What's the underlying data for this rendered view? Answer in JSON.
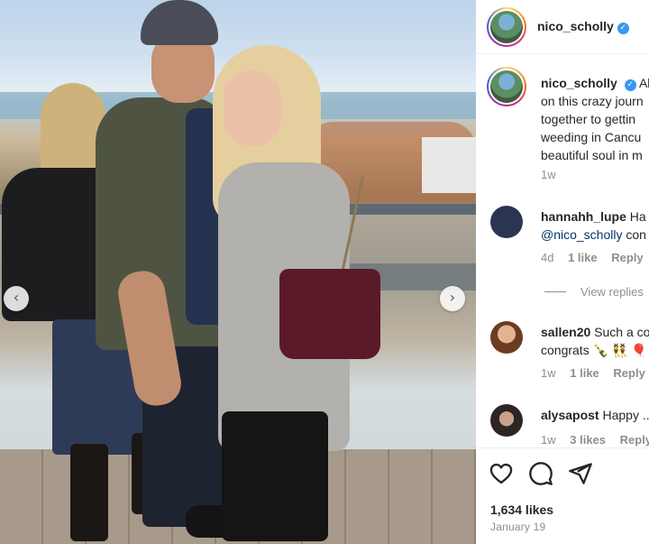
{
  "post": {
    "author": "nico_scholly",
    "verified": true,
    "caption_lines": [
      "Al",
      "on this crazy journ",
      "together to gettin",
      "weeding in Cancu",
      "beautiful soul in m"
    ],
    "time": "1w",
    "likes": "1,634 likes",
    "date": "January 19"
  },
  "comments": [
    {
      "username": "hannahh_lupe",
      "text": "Ha",
      "line2_mention": "@nico_scholly",
      "line2_text": " con",
      "time": "4d",
      "likes": "1 like",
      "reply": "Reply",
      "avatar_color": "#2b3550"
    },
    {
      "username": "sallen20",
      "text": "Such a co",
      "line2_text": "congrats 🍾 👯 🎈",
      "time": "1w",
      "likes": "1 like",
      "reply": "Reply",
      "avatar_color": "#7a4b32"
    },
    {
      "username": "alysapost",
      "text": "Happy ...",
      "time": "1w",
      "likes": "3 likes",
      "reply": "Reply",
      "avatar_color": "#3a302c"
    }
  ],
  "view_replies": "View replies",
  "icons": {
    "like": "heart-icon",
    "comment": "comment-icon",
    "share": "share-icon",
    "prev": "chevron-left-icon",
    "next": "chevron-right-icon",
    "verified": "verified-badge-icon"
  },
  "carousel": {
    "prev_glyph": "‹",
    "next_glyph": "›"
  },
  "colors": {
    "verified": "#3897f0",
    "mention": "#00376b",
    "meta": "#8e8e8e"
  }
}
